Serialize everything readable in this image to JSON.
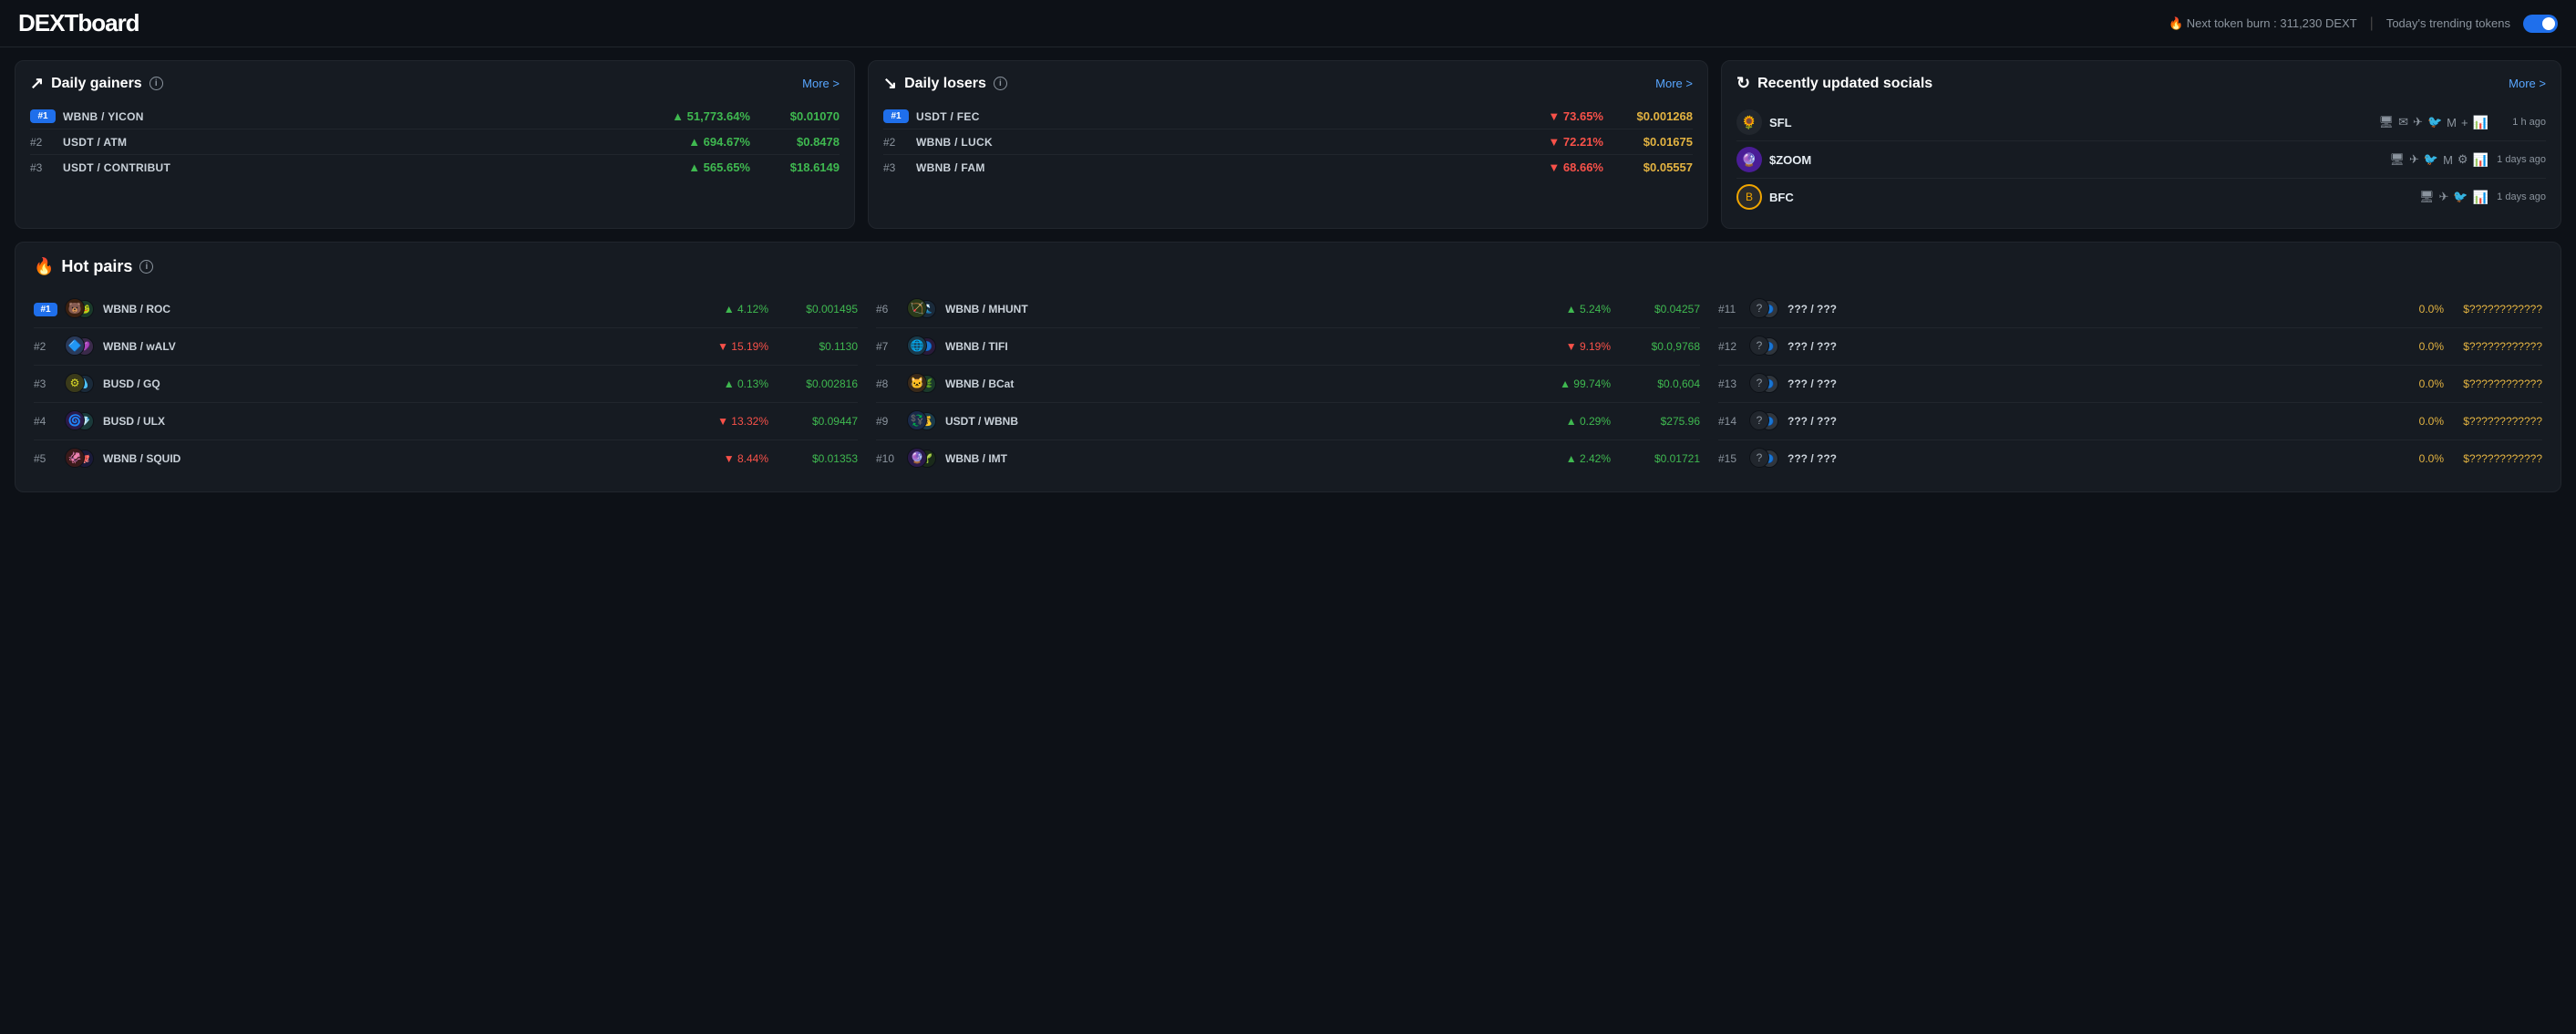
{
  "header": {
    "logo": "DEXTboard",
    "tokenBurn": "🔥 Next token burn : 311,230 DEXT",
    "divider": "|",
    "trendingLabel": "Today's trending tokens"
  },
  "dailyGainers": {
    "title": "Daily gainers",
    "moreLabel": "More >",
    "items": [
      {
        "rank": "#1",
        "pair": "WBNB / YICON",
        "pct": "51,773.64%",
        "price": "$0.01070"
      },
      {
        "rank": "#2",
        "pair": "USDT / ATM",
        "pct": "694.67%",
        "price": "$0.8478"
      },
      {
        "rank": "#3",
        "pair": "USDT / CONTRIBUT",
        "pct": "565.65%",
        "price": "$18.6149"
      }
    ]
  },
  "dailyLosers": {
    "title": "Daily losers",
    "moreLabel": "More >",
    "items": [
      {
        "rank": "#1",
        "pair": "USDT / FEC",
        "pct": "73.65%",
        "price": "$0.001268"
      },
      {
        "rank": "#2",
        "pair": "WBNB / LUCK",
        "pct": "72.21%",
        "price": "$0.01675"
      },
      {
        "rank": "#3",
        "pair": "WBNB / FAM",
        "pct": "68.66%",
        "price": "$0.05557"
      }
    ]
  },
  "recentSocials": {
    "title": "Recently updated socials",
    "moreLabel": "More >",
    "items": [
      {
        "name": "SFL",
        "avatar": "🌻",
        "time": "1 h ago",
        "icons": [
          "🖥",
          "✉",
          "📡",
          "🐦",
          "M",
          "+",
          "📊"
        ]
      },
      {
        "name": "$ZOOM",
        "avatar": "🔮",
        "time": "1 days ago",
        "icons": [
          "🖥",
          "📡",
          "🐦",
          "M",
          "⚙",
          "📊"
        ]
      },
      {
        "name": "BFC",
        "avatar": "🪙",
        "time": "1 days ago",
        "icons": [
          "🖥",
          "📡",
          "🐦",
          "📊"
        ]
      }
    ]
  },
  "hotPairs": {
    "title": "Hot pairs",
    "col1": [
      {
        "rank": "#1",
        "isFirst": true,
        "name": "WBNB / ROC",
        "pct": "4.12%",
        "price": "$0.001495",
        "pctPos": true
      },
      {
        "rank": "#2",
        "isFirst": false,
        "name": "WBNB / wALV",
        "pct": "15.19%",
        "price": "$0.1130",
        "pctPos": false
      },
      {
        "rank": "#3",
        "isFirst": false,
        "name": "BUSD / GQ",
        "pct": "0.13%",
        "price": "$0.002816",
        "pctPos": true
      },
      {
        "rank": "#4",
        "isFirst": false,
        "name": "BUSD / ULX",
        "pct": "13.32%",
        "price": "$0.09447",
        "pctPos": false
      },
      {
        "rank": "#5",
        "isFirst": false,
        "name": "WBNB / SQUID",
        "pct": "8.44%",
        "price": "$0.01353",
        "pctPos": false
      }
    ],
    "col2": [
      {
        "rank": "#6",
        "name": "WBNB / MHUNT",
        "pct": "5.24%",
        "price": "$0.04257",
        "pctPos": true
      },
      {
        "rank": "#7",
        "name": "WBNB / TIFI",
        "pct": "9.19%",
        "price": "$0.0,9768",
        "pctPos": false
      },
      {
        "rank": "#8",
        "name": "WBNB / BCat",
        "pct": "99.74%",
        "price": "$0.0,604",
        "pctPos": true
      },
      {
        "rank": "#9",
        "name": "USDT / WBNB",
        "pct": "0.29%",
        "price": "$275.96",
        "pctPos": true
      },
      {
        "rank": "#10",
        "name": "WBNB / IMT",
        "pct": "2.42%",
        "price": "$0.01721",
        "pctPos": true
      }
    ],
    "col3": [
      {
        "rank": "#11",
        "name": "??? / ???",
        "pct": "0.0%",
        "price": "$????????????",
        "pctPos": true
      },
      {
        "rank": "#12",
        "name": "??? / ???",
        "pct": "0.0%",
        "price": "$????????????",
        "pctPos": true
      },
      {
        "rank": "#13",
        "name": "??? / ???",
        "pct": "0.0%",
        "price": "$????????????",
        "pctPos": true
      },
      {
        "rank": "#14",
        "name": "??? / ???",
        "pct": "0.0%",
        "price": "$????????????",
        "pctPos": true
      },
      {
        "rank": "#15",
        "name": "??? / ???",
        "pct": "0.0%",
        "price": "$????????????",
        "pctPos": true
      }
    ]
  }
}
